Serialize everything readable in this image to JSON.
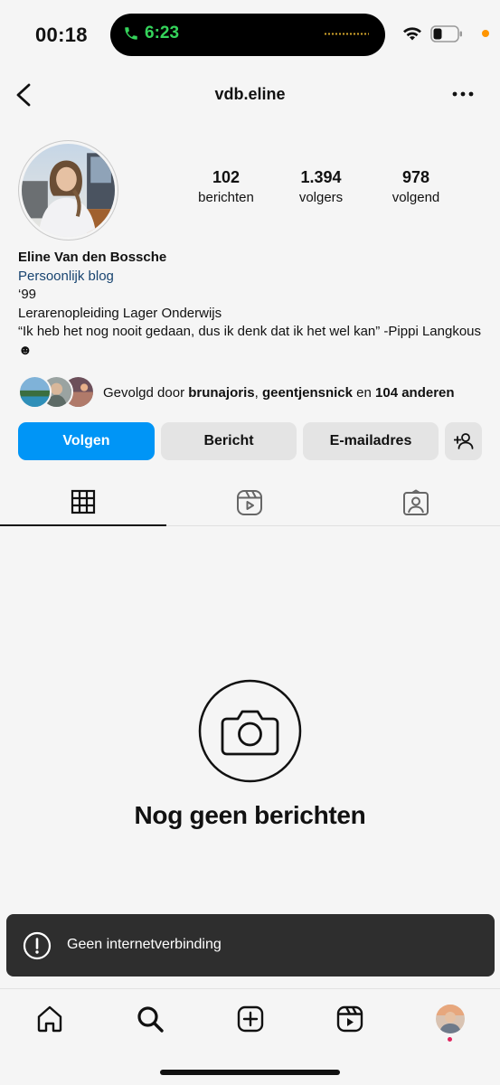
{
  "status_bar": {
    "time": "00:18",
    "call_time": "6:23",
    "icons": [
      "phone-icon",
      "wifi-icon",
      "battery-icon"
    ]
  },
  "header": {
    "username": "vdb.eline",
    "back_icon": "chevron-left-icon",
    "more_icon": "more-horizontal-icon"
  },
  "profile": {
    "stats": [
      {
        "value": "102",
        "label": "berichten"
      },
      {
        "value": "1.394",
        "label": "volgers"
      },
      {
        "value": "978",
        "label": "volgend"
      }
    ],
    "name": "Eline Van den Bossche",
    "category": "Persoonlijk blog",
    "bio_lines": [
      "‘99",
      "Lerarenopleiding Lager Onderwijs",
      "“Ik heb het nog nooit gedaan, dus ik denk dat ik het wel kan” -Pippi Langkous ☻"
    ],
    "followed_by": {
      "prefix": "Gevolgd door ",
      "user1": "brunajoris",
      "sep": ", ",
      "user2": "geentjensnick",
      "middle": " en ",
      "others": "104 anderen"
    }
  },
  "buttons": {
    "follow": "Volgen",
    "message": "Bericht",
    "email": "E-mailadres",
    "add_user_icon": "add-user-icon"
  },
  "tabs": [
    {
      "icon": "grid-icon",
      "active": true
    },
    {
      "icon": "reels-icon",
      "active": false
    },
    {
      "icon": "tagged-icon",
      "active": false
    }
  ],
  "empty_state": {
    "icon": "camera-icon",
    "title": "Nog geen berichten"
  },
  "toast": {
    "icon": "alert-circle-icon",
    "text": "Geen internetverbinding"
  },
  "bottom_nav": [
    {
      "icon": "home-icon"
    },
    {
      "icon": "search-icon"
    },
    {
      "icon": "create-icon"
    },
    {
      "icon": "reels-icon"
    },
    {
      "icon": "profile-avatar"
    }
  ],
  "colors": {
    "primary_button": "#0095f6",
    "secondary_button": "#e4e4e4",
    "background": "#f5f5f5",
    "category_link": "#184470",
    "toast_bg": "#2e2e2e",
    "call_green": "#35d45b"
  }
}
